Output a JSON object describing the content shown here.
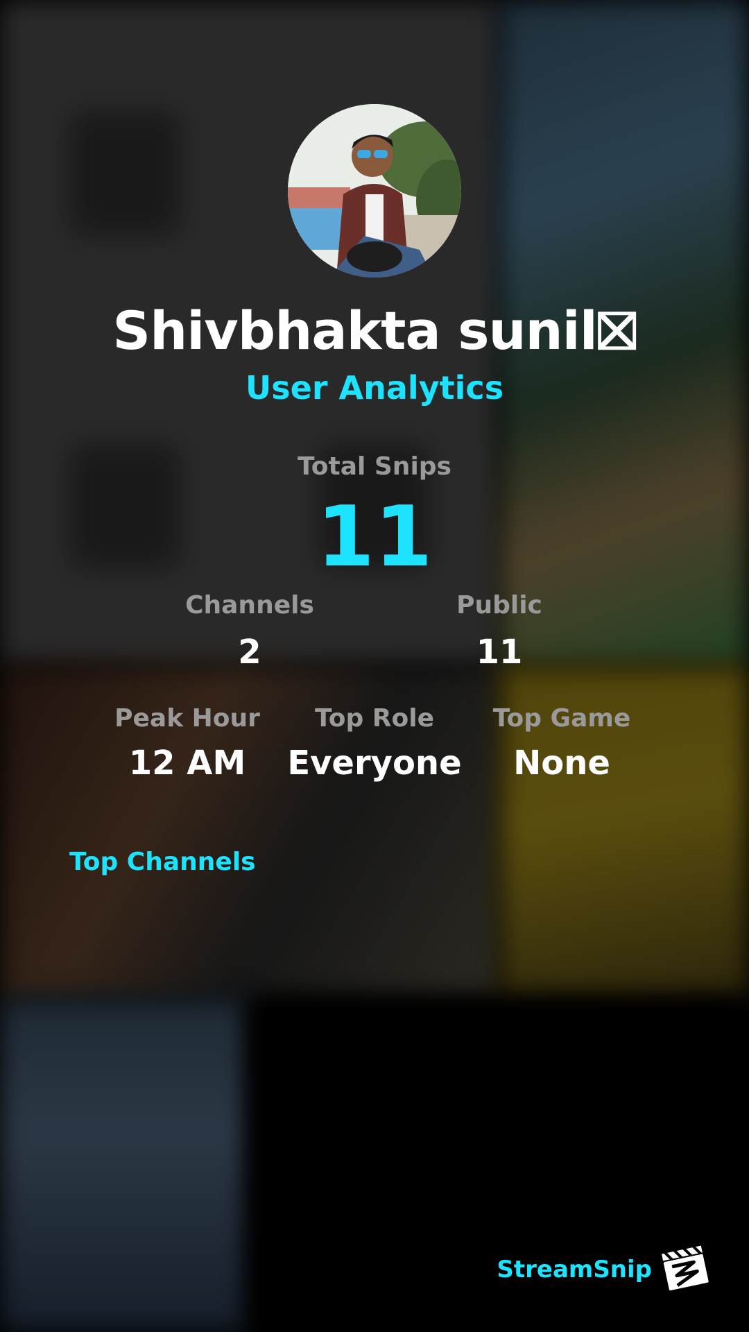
{
  "profile": {
    "name": "Shivbhakta sunil⛝",
    "subtitle": "User Analytics"
  },
  "stats": {
    "total_snips": {
      "label": "Total Snips",
      "value": "11"
    },
    "channels": {
      "label": "Channels",
      "value": "2"
    },
    "public": {
      "label": "Public",
      "value": "11"
    },
    "peak_hour": {
      "label": "Peak Hour",
      "value": "12 AM"
    },
    "top_role": {
      "label": "Top Role",
      "value": "Everyone"
    },
    "top_game": {
      "label": "Top Game",
      "value": "None"
    }
  },
  "sections": {
    "top_channels": "Top Channels"
  },
  "brand": {
    "name": "StreamSnip",
    "logo_icon": "clapperboard-icon"
  },
  "colors": {
    "accent": "#1ee3ff",
    "label_gray": "#9a9a9a",
    "text": "#ffffff"
  }
}
